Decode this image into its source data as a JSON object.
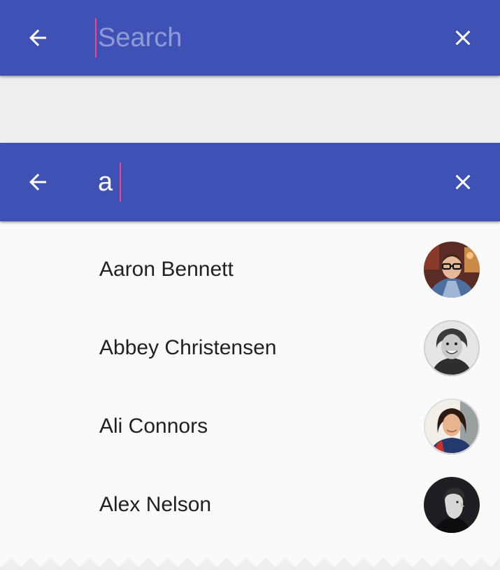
{
  "empty_search": {
    "placeholder": "Search",
    "back_icon": "arrow-left-icon",
    "clear_icon": "close-icon"
  },
  "active_search": {
    "query": "a",
    "back_icon": "arrow-left-icon",
    "clear_icon": "close-icon"
  },
  "results": [
    {
      "name": "Aaron Bennett"
    },
    {
      "name": "Abbey Christensen"
    },
    {
      "name": "Ali Connors"
    },
    {
      "name": "Alex Nelson"
    }
  ],
  "colors": {
    "app_bar": "#3f51b5",
    "accent_caret": "#ff4081",
    "background": "#eeeeee",
    "list_background": "#fafafa",
    "text": "#212121"
  }
}
